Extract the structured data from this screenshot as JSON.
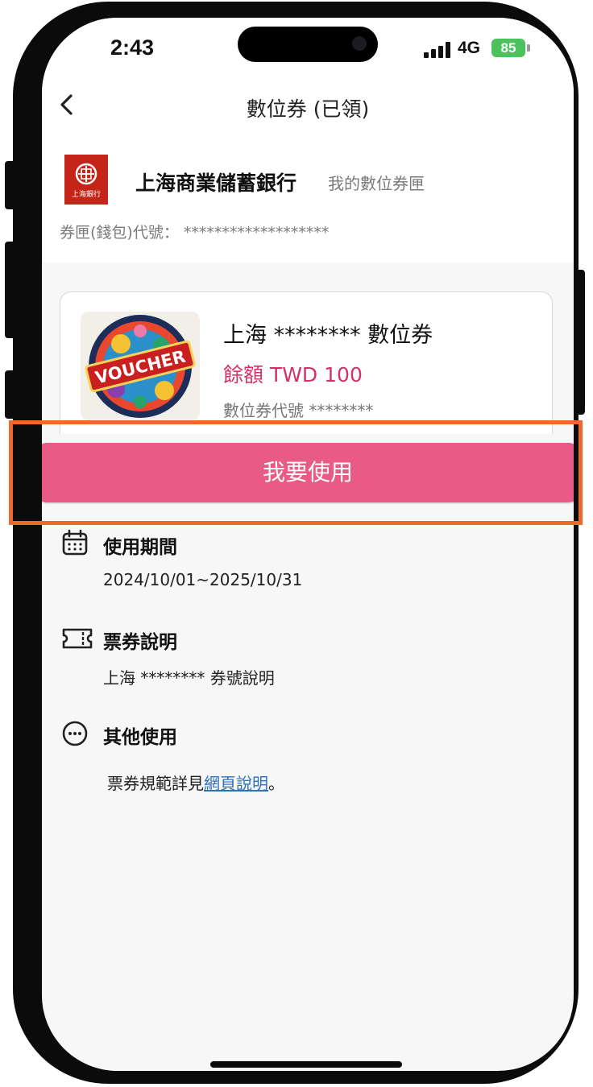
{
  "status_bar": {
    "time": "2:43",
    "network": "4G",
    "battery": "85"
  },
  "header": {
    "title": "數位券 (已領)"
  },
  "bank": {
    "name": "上海商業儲蓄銀行",
    "subtitle": "我的數位券匣",
    "logo_text": "上海銀行",
    "wallet_label": "券匣(錢包)代號：",
    "wallet_value": "*******************"
  },
  "voucher": {
    "image_text": "VOUCHER",
    "title": "上海 ******** 數位券",
    "balance": "餘額 TWD 100",
    "code_label": "數位券代號",
    "code_value": "********"
  },
  "action": {
    "use_label": "我要使用"
  },
  "sections": {
    "period": {
      "title": "使用期間",
      "text": "2024/10/01~2025/10/31"
    },
    "description": {
      "title": "票券說明",
      "text": "上海 ******** 券號說明"
    },
    "other": {
      "title": "其他使用",
      "text_prefix": "票券規範詳見",
      "link": "網頁說明",
      "text_suffix": "。"
    }
  },
  "colors": {
    "accent_button": "#ea5a87",
    "balance_text": "#d4306a",
    "highlight_border": "#ec6a2f",
    "logo_red": "#c52419",
    "battery_green": "#4cc25c",
    "link": "#2f6fc0"
  },
  "icons": [
    "chevron-left-icon",
    "calendar-icon",
    "ticket-icon",
    "more-dots-icon",
    "signal-icon",
    "battery-icon"
  ]
}
